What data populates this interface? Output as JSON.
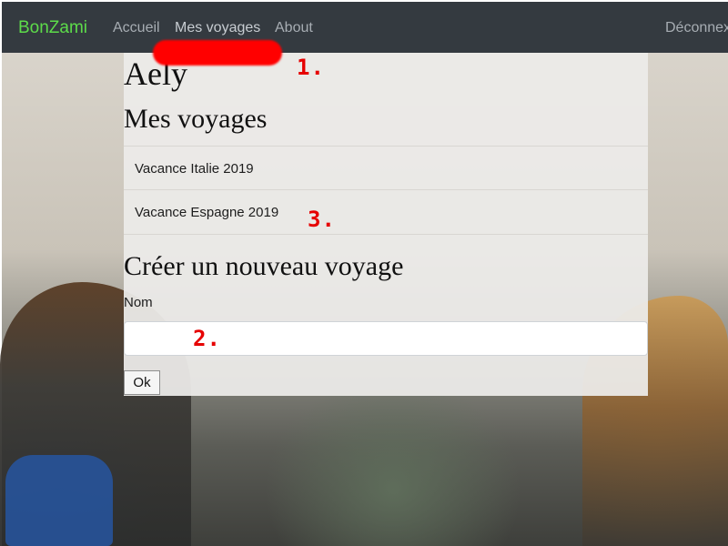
{
  "navbar": {
    "brand": "BonZami",
    "links": [
      "Accueil",
      "Mes voyages",
      "About"
    ],
    "logout": "Déconnex"
  },
  "page": {
    "user_name": "Aely",
    "section_title": "Mes voyages",
    "trips": [
      "Vacance Italie 2019",
      "Vacance Espagne 2019"
    ],
    "create_title": "Créer un nouveau voyage",
    "field_label": "Nom",
    "name_value": "",
    "ok_label": "Ok"
  },
  "annotations": [
    "1.",
    "2.",
    "3."
  ],
  "colors": {
    "navbar_bg": "#343a40",
    "brand": "#5ddc4a",
    "nav_link": "#a7adb3",
    "annotation": "#e60000"
  }
}
